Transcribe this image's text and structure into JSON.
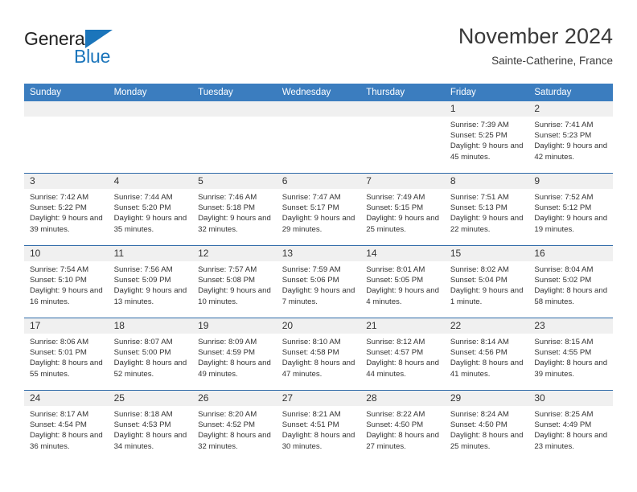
{
  "brand": {
    "word1": "General",
    "word2": "Blue",
    "logo_icon": "triangle-logo-icon",
    "accent_color": "#1b75bb"
  },
  "header": {
    "title": "November 2024",
    "subtitle": "Sainte-Catherine, France"
  },
  "calendar": {
    "header_bg": "#3b7dbf",
    "daynum_bg": "#f0f0f0",
    "weekdays": [
      "Sunday",
      "Monday",
      "Tuesday",
      "Wednesday",
      "Thursday",
      "Friday",
      "Saturday"
    ],
    "weeks": [
      [
        {
          "day": "",
          "empty": true,
          "sunrise": "",
          "sunset": "",
          "daylight": ""
        },
        {
          "day": "",
          "empty": true,
          "sunrise": "",
          "sunset": "",
          "daylight": ""
        },
        {
          "day": "",
          "empty": true,
          "sunrise": "",
          "sunset": "",
          "daylight": ""
        },
        {
          "day": "",
          "empty": true,
          "sunrise": "",
          "sunset": "",
          "daylight": ""
        },
        {
          "day": "",
          "empty": true,
          "sunrise": "",
          "sunset": "",
          "daylight": ""
        },
        {
          "day": "1",
          "empty": false,
          "sunrise": "Sunrise: 7:39 AM",
          "sunset": "Sunset: 5:25 PM",
          "daylight": "Daylight: 9 hours and 45 minutes."
        },
        {
          "day": "2",
          "empty": false,
          "sunrise": "Sunrise: 7:41 AM",
          "sunset": "Sunset: 5:23 PM",
          "daylight": "Daylight: 9 hours and 42 minutes."
        }
      ],
      [
        {
          "day": "3",
          "empty": false,
          "sunrise": "Sunrise: 7:42 AM",
          "sunset": "Sunset: 5:22 PM",
          "daylight": "Daylight: 9 hours and 39 minutes."
        },
        {
          "day": "4",
          "empty": false,
          "sunrise": "Sunrise: 7:44 AM",
          "sunset": "Sunset: 5:20 PM",
          "daylight": "Daylight: 9 hours and 35 minutes."
        },
        {
          "day": "5",
          "empty": false,
          "sunrise": "Sunrise: 7:46 AM",
          "sunset": "Sunset: 5:18 PM",
          "daylight": "Daylight: 9 hours and 32 minutes."
        },
        {
          "day": "6",
          "empty": false,
          "sunrise": "Sunrise: 7:47 AM",
          "sunset": "Sunset: 5:17 PM",
          "daylight": "Daylight: 9 hours and 29 minutes."
        },
        {
          "day": "7",
          "empty": false,
          "sunrise": "Sunrise: 7:49 AM",
          "sunset": "Sunset: 5:15 PM",
          "daylight": "Daylight: 9 hours and 25 minutes."
        },
        {
          "day": "8",
          "empty": false,
          "sunrise": "Sunrise: 7:51 AM",
          "sunset": "Sunset: 5:13 PM",
          "daylight": "Daylight: 9 hours and 22 minutes."
        },
        {
          "day": "9",
          "empty": false,
          "sunrise": "Sunrise: 7:52 AM",
          "sunset": "Sunset: 5:12 PM",
          "daylight": "Daylight: 9 hours and 19 minutes."
        }
      ],
      [
        {
          "day": "10",
          "empty": false,
          "sunrise": "Sunrise: 7:54 AM",
          "sunset": "Sunset: 5:10 PM",
          "daylight": "Daylight: 9 hours and 16 minutes."
        },
        {
          "day": "11",
          "empty": false,
          "sunrise": "Sunrise: 7:56 AM",
          "sunset": "Sunset: 5:09 PM",
          "daylight": "Daylight: 9 hours and 13 minutes."
        },
        {
          "day": "12",
          "empty": false,
          "sunrise": "Sunrise: 7:57 AM",
          "sunset": "Sunset: 5:08 PM",
          "daylight": "Daylight: 9 hours and 10 minutes."
        },
        {
          "day": "13",
          "empty": false,
          "sunrise": "Sunrise: 7:59 AM",
          "sunset": "Sunset: 5:06 PM",
          "daylight": "Daylight: 9 hours and 7 minutes."
        },
        {
          "day": "14",
          "empty": false,
          "sunrise": "Sunrise: 8:01 AM",
          "sunset": "Sunset: 5:05 PM",
          "daylight": "Daylight: 9 hours and 4 minutes."
        },
        {
          "day": "15",
          "empty": false,
          "sunrise": "Sunrise: 8:02 AM",
          "sunset": "Sunset: 5:04 PM",
          "daylight": "Daylight: 9 hours and 1 minute."
        },
        {
          "day": "16",
          "empty": false,
          "sunrise": "Sunrise: 8:04 AM",
          "sunset": "Sunset: 5:02 PM",
          "daylight": "Daylight: 8 hours and 58 minutes."
        }
      ],
      [
        {
          "day": "17",
          "empty": false,
          "sunrise": "Sunrise: 8:06 AM",
          "sunset": "Sunset: 5:01 PM",
          "daylight": "Daylight: 8 hours and 55 minutes."
        },
        {
          "day": "18",
          "empty": false,
          "sunrise": "Sunrise: 8:07 AM",
          "sunset": "Sunset: 5:00 PM",
          "daylight": "Daylight: 8 hours and 52 minutes."
        },
        {
          "day": "19",
          "empty": false,
          "sunrise": "Sunrise: 8:09 AM",
          "sunset": "Sunset: 4:59 PM",
          "daylight": "Daylight: 8 hours and 49 minutes."
        },
        {
          "day": "20",
          "empty": false,
          "sunrise": "Sunrise: 8:10 AM",
          "sunset": "Sunset: 4:58 PM",
          "daylight": "Daylight: 8 hours and 47 minutes."
        },
        {
          "day": "21",
          "empty": false,
          "sunrise": "Sunrise: 8:12 AM",
          "sunset": "Sunset: 4:57 PM",
          "daylight": "Daylight: 8 hours and 44 minutes."
        },
        {
          "day": "22",
          "empty": false,
          "sunrise": "Sunrise: 8:14 AM",
          "sunset": "Sunset: 4:56 PM",
          "daylight": "Daylight: 8 hours and 41 minutes."
        },
        {
          "day": "23",
          "empty": false,
          "sunrise": "Sunrise: 8:15 AM",
          "sunset": "Sunset: 4:55 PM",
          "daylight": "Daylight: 8 hours and 39 minutes."
        }
      ],
      [
        {
          "day": "24",
          "empty": false,
          "sunrise": "Sunrise: 8:17 AM",
          "sunset": "Sunset: 4:54 PM",
          "daylight": "Daylight: 8 hours and 36 minutes."
        },
        {
          "day": "25",
          "empty": false,
          "sunrise": "Sunrise: 8:18 AM",
          "sunset": "Sunset: 4:53 PM",
          "daylight": "Daylight: 8 hours and 34 minutes."
        },
        {
          "day": "26",
          "empty": false,
          "sunrise": "Sunrise: 8:20 AM",
          "sunset": "Sunset: 4:52 PM",
          "daylight": "Daylight: 8 hours and 32 minutes."
        },
        {
          "day": "27",
          "empty": false,
          "sunrise": "Sunrise: 8:21 AM",
          "sunset": "Sunset: 4:51 PM",
          "daylight": "Daylight: 8 hours and 30 minutes."
        },
        {
          "day": "28",
          "empty": false,
          "sunrise": "Sunrise: 8:22 AM",
          "sunset": "Sunset: 4:50 PM",
          "daylight": "Daylight: 8 hours and 27 minutes."
        },
        {
          "day": "29",
          "empty": false,
          "sunrise": "Sunrise: 8:24 AM",
          "sunset": "Sunset: 4:50 PM",
          "daylight": "Daylight: 8 hours and 25 minutes."
        },
        {
          "day": "30",
          "empty": false,
          "sunrise": "Sunrise: 8:25 AM",
          "sunset": "Sunset: 4:49 PM",
          "daylight": "Daylight: 8 hours and 23 minutes."
        }
      ]
    ]
  }
}
